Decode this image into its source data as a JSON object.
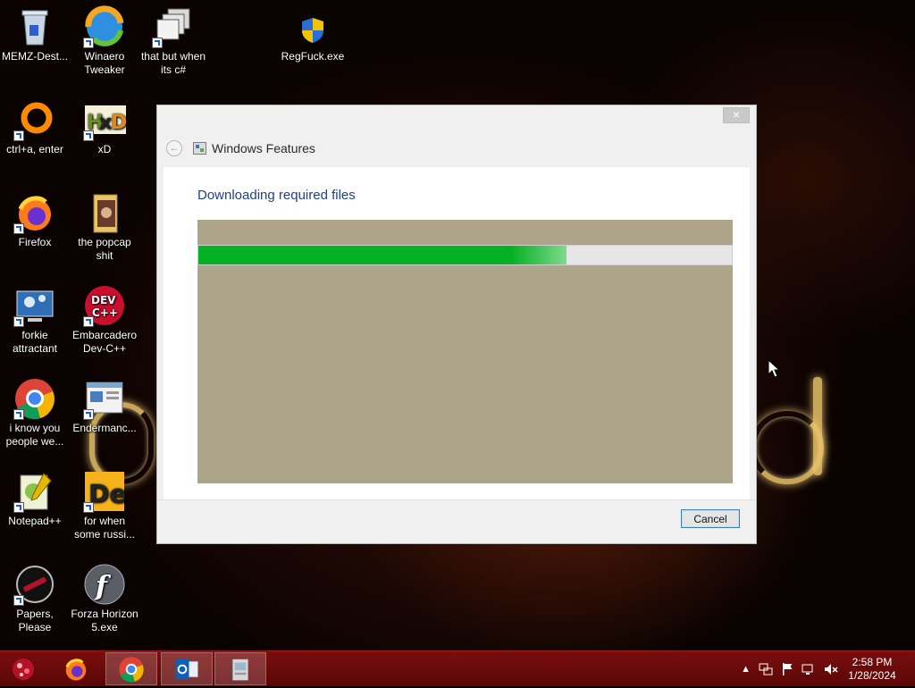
{
  "desktop": {
    "icons": [
      {
        "label": "MEMZ-Dest...",
        "icon": "recycle-bin-icon"
      },
      {
        "label": "Winaero Tweaker",
        "icon": "winaero-icon"
      },
      {
        "label": "that but when its c#",
        "icon": "windows-stack-icon"
      },
      {
        "label": "RegFuck.exe",
        "icon": "uac-shield-icon"
      },
      {
        "label": "ctrl+a, enter",
        "icon": "ring-icon"
      },
      {
        "label": "xD",
        "icon": "hxd-icon"
      },
      {
        "label": "Firefox",
        "icon": "firefox-icon"
      },
      {
        "label": "the popcap shit",
        "icon": "folder-icon"
      },
      {
        "label": "forkie attractant",
        "icon": "settings-monitor-icon"
      },
      {
        "label": "Embarcadero Dev-C++",
        "icon": "devcpp-icon"
      },
      {
        "label": "i know you people we...",
        "icon": "chrome-icon"
      },
      {
        "label": "Endermanc...",
        "icon": "window-app-icon"
      },
      {
        "label": "Notepad++",
        "icon": "notepadpp-icon"
      },
      {
        "label": "for when some russi...",
        "icon": "de-icon"
      },
      {
        "label": "Papers, Please",
        "icon": "papers-please-icon"
      },
      {
        "label": "Forza Horizon 5.exe",
        "icon": "flash-icon"
      }
    ]
  },
  "window": {
    "title": "Windows Features",
    "close_label": "×",
    "back_label": "←",
    "heading": "Downloading required files",
    "progress": 0.69,
    "cancel_label": "Cancel",
    "colors": {
      "progress": "#06b025",
      "heading": "#1e3f8a"
    }
  },
  "taskbar": {
    "apps": [
      "firefox-icon",
      "chrome-icon",
      "outlook-icon",
      "installer-icon"
    ],
    "active_app": "chrome-icon",
    "tray_icons": [
      "chevron-up-icon",
      "network-icon",
      "flag-icon",
      "display-icon",
      "volume-muted-icon"
    ],
    "time": "2:58 PM",
    "date": "1/28/2024"
  }
}
